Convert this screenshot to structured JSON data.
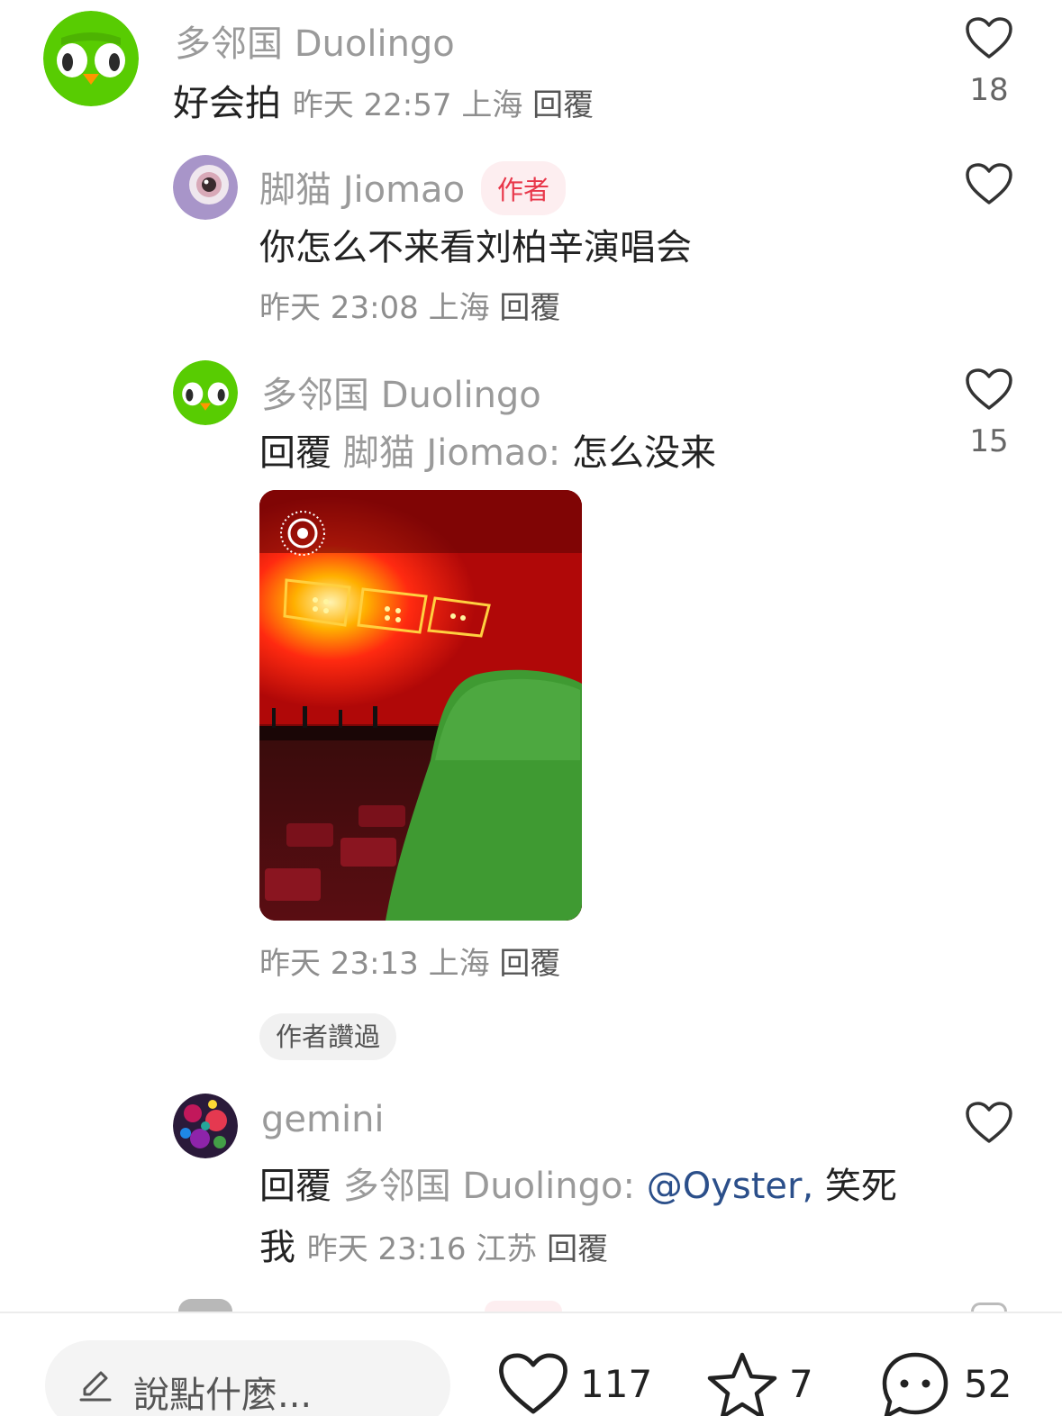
{
  "colors": {
    "accent_red": "#e8374a",
    "mention_blue": "#2b4f8a",
    "duolingo_green": "#58cc02"
  },
  "comments": [
    {
      "username": "多邻国 Duolingo",
      "avatar_icon": "duolingo-owl-icon",
      "text": "好会拍",
      "time": "昨天 22:57",
      "location": "上海",
      "reply_label": "回覆",
      "likes": "18"
    },
    {
      "username": "脚猫 Jiomao",
      "badge": "作者",
      "avatar_icon": "eye-avatar-icon",
      "text": "你怎么不来看刘柏辛演唱会",
      "time": "昨天 23:08",
      "location": "上海",
      "reply_label": "回覆"
    },
    {
      "username": "多邻国 Duolingo",
      "avatar_icon": "duolingo-owl-icon",
      "reply_prefix": "回覆",
      "reply_target": "脚猫 Jiomao:",
      "text": "怎么没来",
      "likes": "15",
      "image_icon": "concert-photo-live-icon",
      "time": "昨天 23:13",
      "location": "上海",
      "reply_label": "回覆",
      "author_praised": "作者讚過"
    },
    {
      "username": "gemini",
      "avatar_icon": "floral-avatar-icon",
      "reply_prefix": "回覆",
      "reply_target": "多邻国 Duolingo:",
      "mention": "@Oyster,",
      "text": "笑死",
      "text_continued": "我",
      "time": "昨天 23:16",
      "location": "江苏",
      "reply_label": "回覆"
    }
  ],
  "bottom_bar": {
    "input_placeholder": "說點什麼...",
    "likes": "117",
    "stars": "7",
    "comments": "52"
  }
}
